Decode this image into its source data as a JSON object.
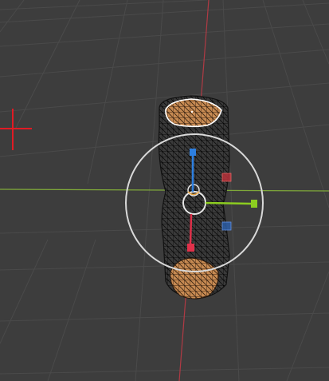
{
  "viewport": {
    "name": "3D Viewport",
    "background": "#3d3d3d",
    "grid_color": "#4a4a4a",
    "axis_x_color": "#7fa83a",
    "axis_y_color": "#b03a44"
  },
  "gizmo": {
    "mode": "translate",
    "x_color": "#8ccc20",
    "y_color": "#e0314a",
    "z_color": "#2d7fe0",
    "ring_color": "#d9d9d9"
  },
  "mesh": {
    "mode": "edit",
    "edge_color": "#000000",
    "selected_face_color": "#c78a52",
    "selection_outline": "#ffffff"
  },
  "cursor_3d": {
    "icon": "3d-cursor-icon",
    "color": "#e01b24"
  }
}
